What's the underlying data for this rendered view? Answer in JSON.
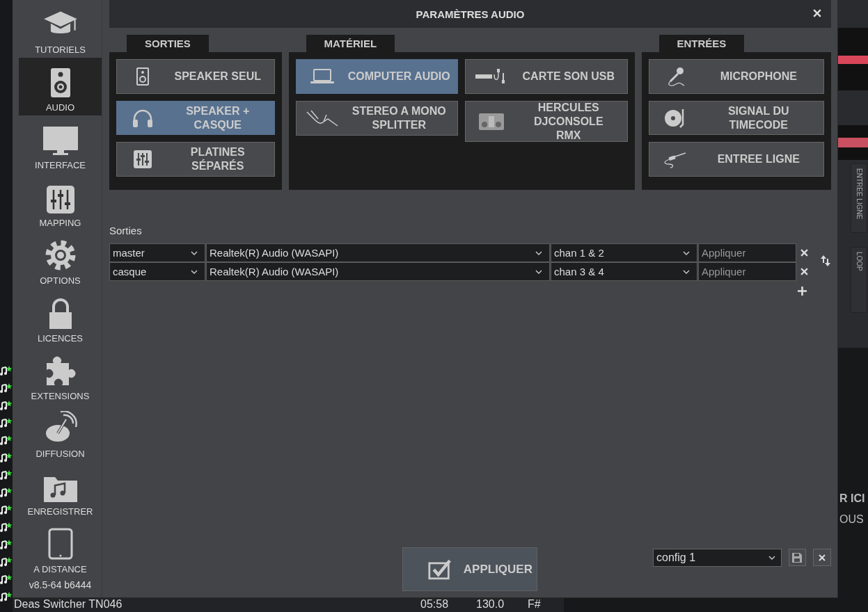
{
  "background": {
    "side_labels": [
      {
        "label": "ENTREE LIGNE"
      },
      {
        "label": "LOOP"
      }
    ],
    "promo_lines": [
      "R ICI",
      "OUS"
    ],
    "track": {
      "title": "Deas  Switcher TN046",
      "time": "05:58",
      "bpm": "130.0",
      "key": "F#"
    }
  },
  "dialog": {
    "title": "PARAMÈTRES AUDIO",
    "sidebar": [
      {
        "label": "TUTORIELS",
        "selected": false
      },
      {
        "label": "AUDIO",
        "selected": true
      },
      {
        "label": "INTERFACE",
        "selected": false
      },
      {
        "label": "MAPPING",
        "selected": false
      },
      {
        "label": "OPTIONS",
        "selected": false
      },
      {
        "label": "LICENCES",
        "selected": false
      },
      {
        "label": "EXTENSIONS",
        "selected": false
      },
      {
        "label": "DIFFUSION",
        "selected": false
      },
      {
        "label": "ENREGISTRER",
        "selected": false
      },
      {
        "label": "A DISTANCE",
        "selected": false
      }
    ],
    "version": "v8.5-64 b6444",
    "groups": [
      {
        "title": "SORTIES",
        "buttons": [
          {
            "label": "SPEAKER SEUL",
            "selected": false
          },
          {
            "label": "SPEAKER +\nCASQUE",
            "selected": true
          },
          {
            "label": "PLATINES\nSÉPARÉS",
            "selected": false
          }
        ]
      },
      {
        "title": "MATÉRIEL",
        "buttons": [
          {
            "label": "COMPUTER AUDIO",
            "selected": true
          },
          {
            "label": "CARTE SON USB",
            "selected": false
          },
          {
            "label": "STEREO A MONO\nSPLITTER",
            "selected": false
          },
          {
            "label": "HERCULES\nDJCONSOLE\nRMX",
            "selected": false
          }
        ]
      },
      {
        "title": "ENTRÉES",
        "buttons": [
          {
            "label": "MICROPHONE",
            "selected": false
          },
          {
            "label": "SIGNAL DU\nTIMECODE",
            "selected": false
          },
          {
            "label": "ENTREE LIGNE",
            "selected": false
          }
        ]
      }
    ],
    "outputs": {
      "label": "Sorties",
      "rows": [
        {
          "output": "master",
          "device": "Realtek(R) Audio (WASAPI)",
          "channels": "chan 1 & 2",
          "placeholder": "Appliquer"
        },
        {
          "output": "casque",
          "device": "Realtek(R) Audio (WASAPI)",
          "channels": "chan 3 & 4",
          "placeholder": "Appliquer"
        }
      ]
    },
    "apply_button": "APPLIQUER",
    "config": {
      "value": "config 1"
    }
  }
}
